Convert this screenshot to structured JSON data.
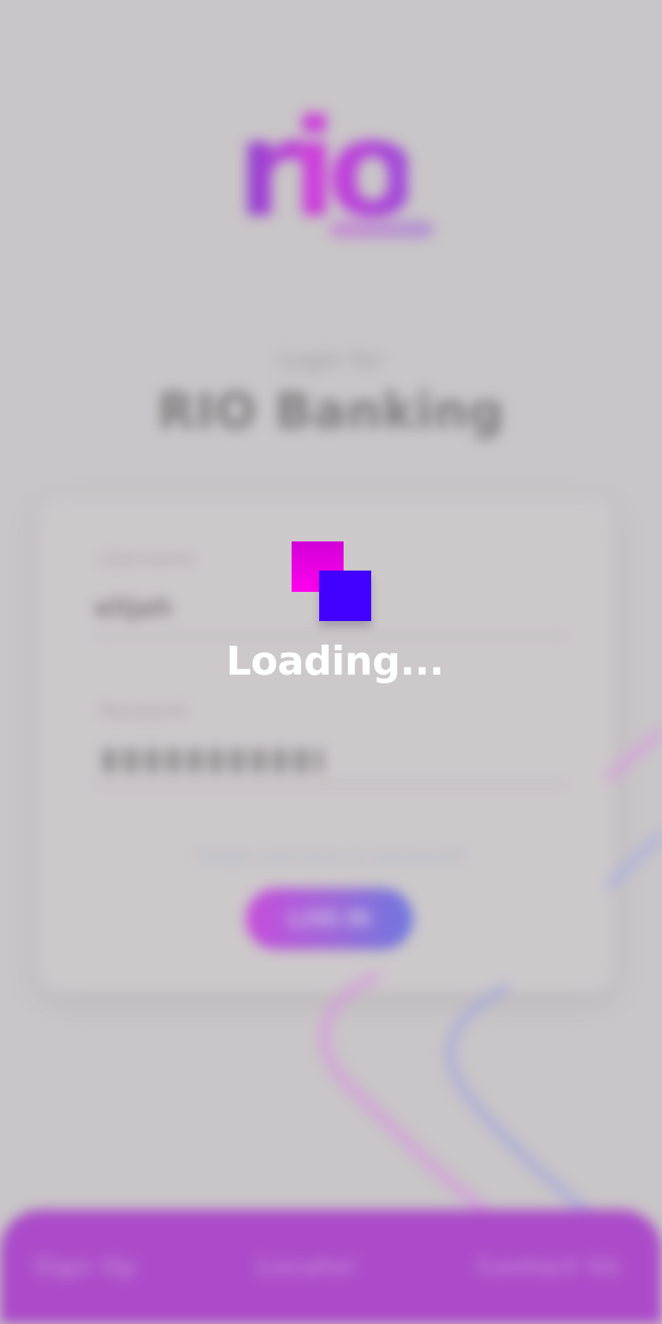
{
  "app": {
    "logo_text": "rio",
    "headline_small": "Login for",
    "headline_large": "RIO Banking"
  },
  "login_form": {
    "username_label": "Username",
    "username_value": "elijah",
    "password_label": "Password",
    "forgot_link": "Forgot username or password?",
    "login_button": "LOG IN"
  },
  "bottom_nav": {
    "items": [
      {
        "label": "Sign Up"
      },
      {
        "label": "Locator"
      },
      {
        "label": "Contact Us"
      }
    ]
  },
  "loading": {
    "label": "Loading..."
  },
  "colors": {
    "background": "#c9c5c8",
    "card": "#d0cbcc",
    "accent_pink": "#ff00ee",
    "accent_blue": "#4200ff",
    "bottom_bar": "#ab4bc9",
    "button_start": "#c74ddb",
    "button_end": "#6f77df"
  },
  "icons": {
    "loading": "loading-squares-icon"
  }
}
